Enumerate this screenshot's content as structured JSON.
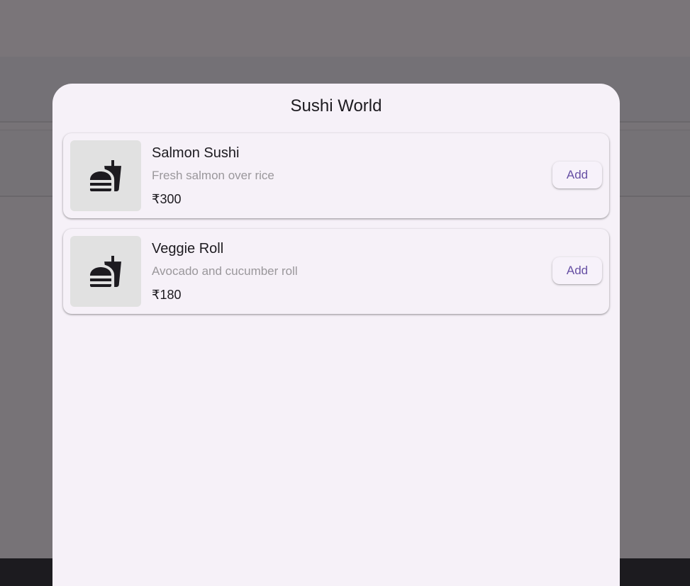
{
  "sheet": {
    "title": "Sushi World"
  },
  "items": [
    {
      "name": "Salmon Sushi",
      "description": "Fresh salmon over rice",
      "price": "₹300",
      "add_label": "Add",
      "icon": "fastfood-icon"
    },
    {
      "name": "Veggie Roll",
      "description": "Avocado and cucumber roll",
      "price": "₹180",
      "add_label": "Add",
      "icon": "fastfood-icon"
    }
  ],
  "colors": {
    "sheet_background": "#f6f1f8",
    "accent": "#6750a4",
    "scrim": "#777377",
    "thumbnail_background": "#e1e1e1"
  }
}
